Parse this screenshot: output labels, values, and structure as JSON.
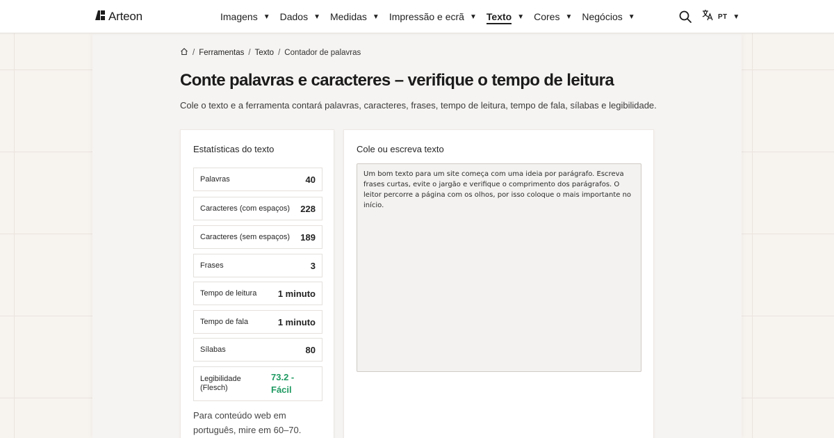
{
  "brand": {
    "name": "Arteon",
    "icon": "logo-mark"
  },
  "nav": {
    "items": [
      {
        "label": "Imagens",
        "active": false
      },
      {
        "label": "Dados",
        "active": false
      },
      {
        "label": "Medidas",
        "active": false
      },
      {
        "label": "Impressão e ecrã",
        "active": false
      },
      {
        "label": "Texto",
        "active": true
      },
      {
        "label": "Cores",
        "active": false
      },
      {
        "label": "Negócios",
        "active": false
      }
    ],
    "caret": "▼",
    "search_icon": "search-icon",
    "language": {
      "code": "PT",
      "icon": "translate-icon"
    }
  },
  "breadcrumb": {
    "home_icon": "home-icon",
    "items": [
      "Ferramentas",
      "Texto",
      "Contador de palavras"
    ],
    "separator": "/"
  },
  "page": {
    "title": "Conte palavras e caracteres – verifique o tempo de leitura",
    "subtitle": "Cole o texto e a ferramenta contará palavras, caracteres, frases, tempo de leitura, tempo de fala, sílabas e legibilidade."
  },
  "stats": {
    "title": "Estatísticas do texto",
    "rows": [
      {
        "label": "Palavras",
        "value": "40"
      },
      {
        "label": "Caracteres (com espaços)",
        "value": "228"
      },
      {
        "label": "Caracteres (sem espaços)",
        "value": "189"
      },
      {
        "label": "Frases",
        "value": "3"
      },
      {
        "label": "Tempo de leitura",
        "value": "1 minuto"
      },
      {
        "label": "Tempo de fala",
        "value": "1 minuto"
      },
      {
        "label": "Sílabas",
        "value": "80"
      },
      {
        "label": "Legibilidade (Flesch)",
        "value": "73.2 - Fácil"
      }
    ],
    "note": "Para conteúdo web em português, mire em 60–70."
  },
  "editor": {
    "label": "Cole ou escreva texto",
    "value": "Um bom texto para um site começa com uma ideia por parágrafo. Escreva frases curtas, evite o jargão e verifique o comprimento dos parágrafos. O leitor percorre a página com os olhos, por isso coloque o mais importante no início."
  },
  "colors": {
    "accent_green": "#1f9a62",
    "background": "#f7f3ef",
    "text": "#1f1f1f"
  }
}
